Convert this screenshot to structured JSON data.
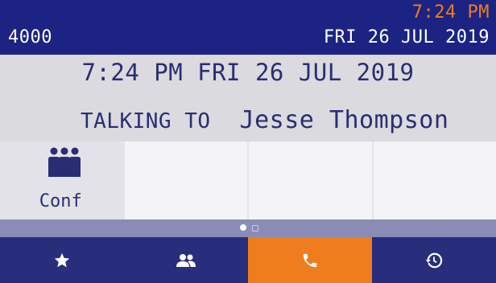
{
  "status_bar": {
    "extension": "4000",
    "time": "7:24 PM",
    "date": "FRI 26 JUL 2019"
  },
  "call": {
    "datetime": "7:24 PM FRI 26 JUL 2019",
    "talking_label": "TALKING TO",
    "caller_name": "Jesse Thompson"
  },
  "softkeys": [
    {
      "label": "Conf",
      "icon": "conference-icon"
    },
    {
      "label": "",
      "icon": ""
    },
    {
      "label": "",
      "icon": ""
    },
    {
      "label": "",
      "icon": ""
    }
  ],
  "page_indicator": {
    "pages": 2,
    "current": 1
  },
  "nav": [
    {
      "icon": "star-icon",
      "active": false
    },
    {
      "icon": "contacts-icon",
      "active": false
    },
    {
      "icon": "phone-icon",
      "active": true
    },
    {
      "icon": "history-icon",
      "active": false
    }
  ],
  "colors": {
    "status_bar_bg": "#1c2382",
    "time_accent": "#f07b1f",
    "text_primary": "#2a2d73",
    "nav_bg": "#282d7c",
    "nav_active": "#ef7d1e"
  }
}
